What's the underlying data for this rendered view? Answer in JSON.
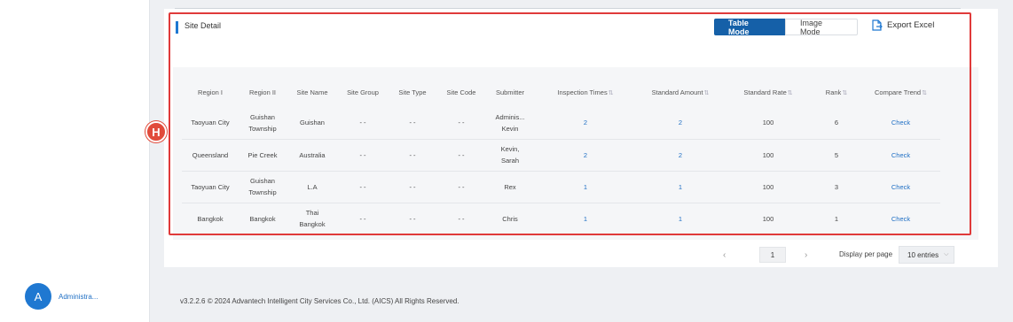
{
  "sidebar": {
    "user": {
      "initial": "A",
      "name": "Administra..."
    }
  },
  "section": {
    "title": "Site Detail",
    "modes": [
      "Table Mode",
      "Image Mode"
    ],
    "export_label": "Export Excel"
  },
  "table": {
    "headers": [
      "Region I",
      "Region II",
      "Site Name",
      "Site Group",
      "Site Type",
      "Site Code",
      "Submitter",
      "Inspection Times",
      "Standard Amount",
      "Standard Rate",
      "Rank",
      "Compare Trend"
    ],
    "rows": [
      [
        "Taoyuan City",
        "Guishan\nTownship",
        "Guishan",
        "- -",
        "- -",
        "- -",
        "Adminis...\nKevin",
        "2",
        "2",
        "100",
        "6",
        "Check"
      ],
      [
        "Queensland",
        "Pie Creek",
        "Australia",
        "- -",
        "- -",
        "- -",
        "Kevin,\nSarah",
        "2",
        "2",
        "100",
        "5",
        "Check"
      ],
      [
        "Taoyuan City",
        "Guishan\nTownship",
        "L.A",
        "- -",
        "- -",
        "- -",
        "Rex",
        "1",
        "1",
        "100",
        "3",
        "Check"
      ],
      [
        "Bangkok",
        "Bangkok",
        "Thai\nBangkok",
        "- -",
        "- -",
        "- -",
        "Chris",
        "1",
        "1",
        "100",
        "1",
        "Check"
      ]
    ]
  },
  "pagination": {
    "current_page": "1",
    "display_label": "Display per page",
    "per_page": "10 entries"
  },
  "marker": {
    "label": "H"
  },
  "footer": {
    "text": "v3.2.2.6 © 2024 Advantech Intelligent City Services Co., Ltd. (AICS) All Rights Reserved."
  },
  "colors": {
    "accent": "#1560a8",
    "link": "#1f6fc4",
    "highlight": "#e03a3a",
    "marker": "#e14b3b"
  }
}
